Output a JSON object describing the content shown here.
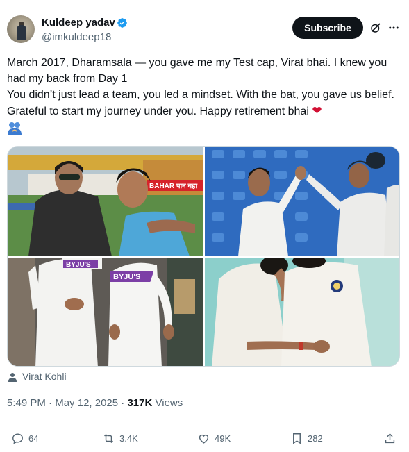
{
  "author": {
    "name": "Kuldeep yadav",
    "handle": "@imkuldeep18",
    "verified_icon": "verified-badge-icon",
    "verified_color": "#1d9bf0"
  },
  "actions_top": {
    "subscribe_label": "Subscribe",
    "grok_icon": "grok-icon",
    "more_icon": "more-icon"
  },
  "tweet_text": {
    "line1": "March 2017, Dharamsala — you gave me my Test cap, Virat bhai. I knew you had my back from Day 1",
    "line2": "You didn’t just lead a team, you led a mindset. With the bat, you gave us belief. Grateful to start my journey under you. Happy retirement bhai",
    "heart_emoji": "❤",
    "people_emoji_icon": "people-hugging-icon"
  },
  "media": {
    "photos": [
      {
        "name": "photo-hug-stadium",
        "signage": "BAHAR पान बहा"
      },
      {
        "name": "photo-high-five-stands"
      },
      {
        "name": "photo-walking-whites",
        "sponsor": "BYJU'S"
      },
      {
        "name": "photo-embrace-teal"
      }
    ]
  },
  "tagged": {
    "icon": "person-tag-icon",
    "name": "Virat Kohli"
  },
  "meta": {
    "time": "5:49 PM",
    "separator": " · ",
    "date": "May 12, 2025",
    "views_count": "317K",
    "views_label": "Views"
  },
  "engagement": {
    "replies": "64",
    "reposts": "3.4K",
    "likes": "49K",
    "bookmarks": "282"
  }
}
